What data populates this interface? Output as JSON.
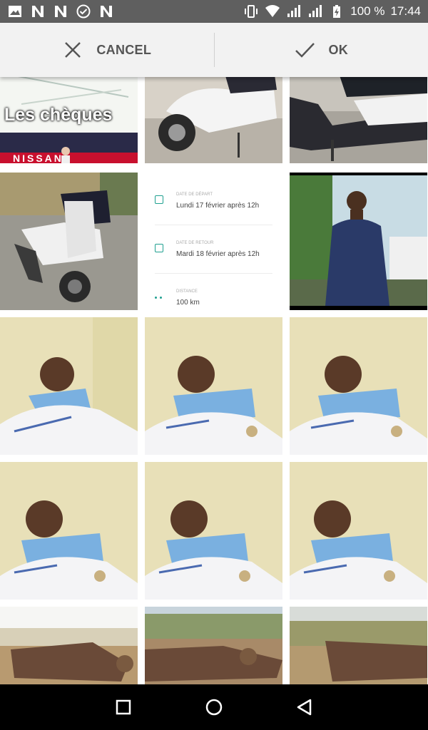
{
  "status_bar": {
    "icons_left": [
      "image-icon",
      "n-icon",
      "n-icon",
      "check-circle-icon",
      "n-icon"
    ],
    "icons_right": [
      "vibrate-icon",
      "wifi-icon",
      "signal-icon",
      "signal-icon",
      "battery-charging-icon"
    ],
    "battery": "100 %",
    "time": "17:44"
  },
  "action_bar": {
    "cancel_label": "CANCEL",
    "ok_label": "OK"
  },
  "grid": {
    "tiles": [
      {
        "kind": "photo",
        "caption": "Les chèques",
        "banner": "NISSAN"
      },
      {
        "kind": "photo",
        "subject": "scooter"
      },
      {
        "kind": "photo",
        "subject": "scooter"
      },
      {
        "kind": "photo",
        "subject": "scooter"
      },
      {
        "kind": "form"
      },
      {
        "kind": "photo",
        "subject": "portrait"
      },
      {
        "kind": "photo",
        "subject": "selfie"
      },
      {
        "kind": "photo",
        "subject": "selfie"
      },
      {
        "kind": "photo",
        "subject": "selfie"
      },
      {
        "kind": "photo",
        "subject": "selfie"
      },
      {
        "kind": "photo",
        "subject": "selfie"
      },
      {
        "kind": "photo",
        "subject": "selfie"
      },
      {
        "kind": "photo",
        "subject": "landscape"
      },
      {
        "kind": "photo",
        "subject": "landscape"
      },
      {
        "kind": "photo",
        "subject": "landscape"
      }
    ],
    "form_tile": {
      "rows": [
        {
          "label": "DATE DE DÉPART",
          "value": "Lundi 17 février après 12h"
        },
        {
          "label": "DATE DE RETOUR",
          "value": "Mardi 18 février après 12h"
        },
        {
          "label": "DISTANCE",
          "value": "100 km"
        }
      ]
    }
  },
  "nav_bar": {
    "buttons": [
      "recents-icon",
      "home-icon",
      "back-icon"
    ]
  },
  "colors": {
    "status_bar": "#5f5f5f",
    "action_bar": "#f2f2f2",
    "action_text": "#555555",
    "accent": "#20a090",
    "nav_bar": "#000000"
  }
}
